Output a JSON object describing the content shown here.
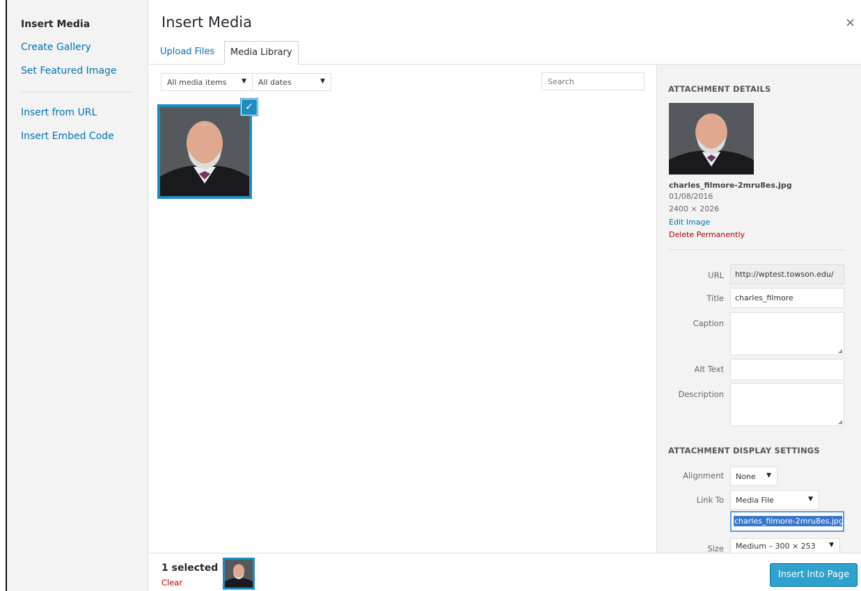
{
  "menu": {
    "items": [
      "Insert Media",
      "Create Gallery",
      "Set Featured Image"
    ],
    "items2": [
      "Insert from URL",
      "Insert Embed Code"
    ]
  },
  "modal": {
    "title": "Insert Media",
    "close_symbol": "×"
  },
  "tabs": [
    {
      "label": "Upload Files"
    },
    {
      "label": "Media Library"
    }
  ],
  "toolbar": {
    "media_filter": "All media items",
    "date_filter": "All dates",
    "search_placeholder": "Search"
  },
  "details": {
    "heading": "ATTACHMENT DETAILS",
    "filename": "charles_filmore-2mru8es.jpg",
    "date": "01/08/2016",
    "dimensions": "2400 × 2026",
    "edit": "Edit Image",
    "delete": "Delete Permanently",
    "url_label": "URL",
    "url_value": "http://wptest.towson.edu/",
    "title_label": "Title",
    "title_value": "charles_filmore",
    "caption_label": "Caption",
    "alt_label": "Alt Text",
    "description_label": "Description"
  },
  "display": {
    "heading": "ATTACHMENT DISPLAY SETTINGS",
    "alignment_label": "Alignment",
    "alignment_value": "None",
    "link_label": "Link To",
    "link_value": "Media File",
    "link_url": "charles_filmore-2mru8es.jpg",
    "size_label": "Size",
    "size_value": "Medium – 300 × 253"
  },
  "bottom": {
    "selected": "1 selected",
    "clear": "Clear",
    "insert": "Insert Into Page"
  },
  "colors": {
    "accent": "#1e8cbe",
    "link": "#0073aa",
    "danger": "#a00",
    "button": "#2ea2cc"
  }
}
